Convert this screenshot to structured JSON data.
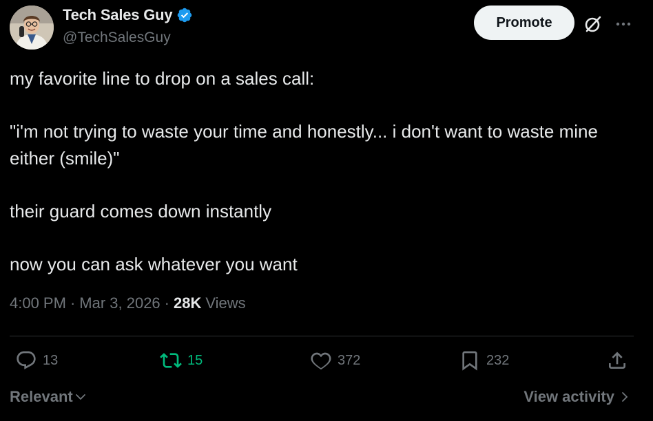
{
  "author": {
    "display_name": "Tech Sales Guy",
    "handle": "@TechSalesGuy",
    "verified": true
  },
  "header_actions": {
    "promote_label": "Promote",
    "grok_icon": "grok-icon",
    "more_icon": "more-icon"
  },
  "tweet": {
    "lines": [
      "my favorite line to drop on a sales call:",
      "",
      "\"i'm not trying to waste your time and honestly... i don't want to waste mine either (smile)\"",
      "",
      "their guard comes down instantly",
      "",
      "now you can ask whatever you want"
    ]
  },
  "meta": {
    "time": "4:00 PM",
    "date": "Mar 3, 2026",
    "views_count": "28K",
    "views_label": "Views",
    "separator": "·"
  },
  "actions": {
    "replies": "13",
    "retweets": "15",
    "likes": "372",
    "bookmarks": "232"
  },
  "footer": {
    "sort_label": "Relevant",
    "activity_label": "View activity"
  },
  "colors": {
    "background": "#000000",
    "text": "#e7e9ea",
    "muted": "#71767b",
    "verified": "#1d9bf0",
    "retweet": "#00ba7c",
    "promote_bg": "#eff3f4"
  }
}
